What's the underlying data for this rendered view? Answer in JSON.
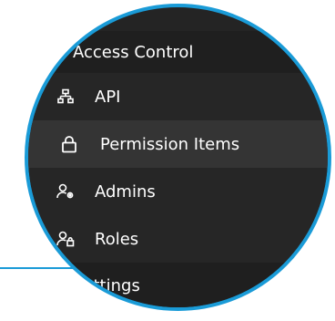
{
  "sidebar": {
    "section_title": "Access Control",
    "items": [
      {
        "label": "API",
        "icon": "sitemap-icon"
      },
      {
        "label": "Permission Items",
        "icon": "lock-icon",
        "active": true
      },
      {
        "label": "Admins",
        "icon": "user-gear-icon"
      },
      {
        "label": "Roles",
        "icon": "user-lock-icon"
      }
    ],
    "footer_label": "Settings"
  },
  "colors": {
    "accent": "#1a9bd7",
    "sidebar_bg": "#262626",
    "active_bg": "#343434",
    "section_bg": "#1f1f1f"
  }
}
